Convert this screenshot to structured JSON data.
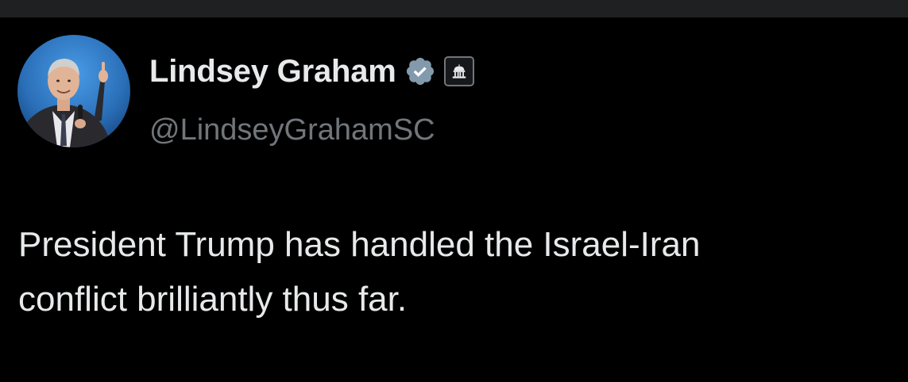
{
  "author": {
    "display_name": "Lindsey Graham",
    "handle": "@LindseyGrahamSC",
    "verified_icon": "verified-checkmark-icon",
    "affiliation_icon": "government-building-icon"
  },
  "tweet": {
    "text_lines": [
      "President Trump has handled the Israel-Iran",
      "conflict brilliantly thus far."
    ]
  },
  "colors": {
    "background": "#000000",
    "top_strip": "#1f2022",
    "primary_text": "#e7e9ea",
    "secondary_text": "#71767b",
    "verified_badge": "#829aab",
    "avatar_background": "#2a6fb8"
  }
}
